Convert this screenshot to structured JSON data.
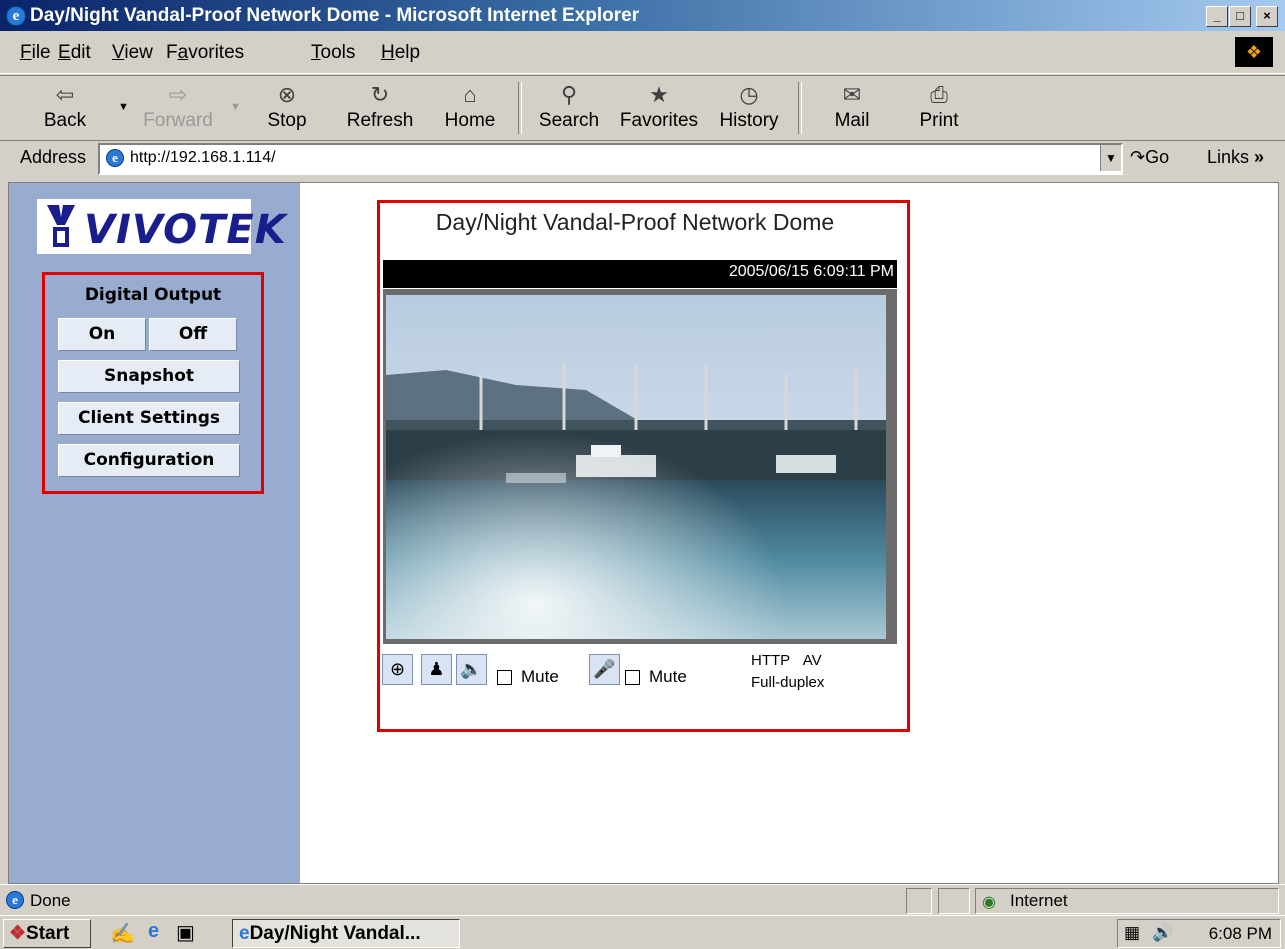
{
  "window": {
    "title": "Day/Night Vandal-Proof Network Dome - Microsoft Internet Explorer",
    "controls": [
      "_",
      "□",
      "×"
    ]
  },
  "menu": {
    "items": [
      "File",
      "Edit",
      "View",
      "Favorites",
      "Tools",
      "Help"
    ],
    "accel": [
      "F",
      "E",
      "V",
      "a",
      "T",
      "H"
    ]
  },
  "toolbar": {
    "back": "Back",
    "forward": "Forward",
    "stop": "Stop",
    "refresh": "Refresh",
    "home": "Home",
    "search": "Search",
    "favorites": "Favorites",
    "history": "History",
    "mail": "Mail",
    "print": "Print"
  },
  "address": {
    "label": "Address",
    "url": "http://192.168.1.114/",
    "go": "Go",
    "links": "Links"
  },
  "sidebar": {
    "logo_text": "VIVOTEK",
    "digital_output_label": "Digital Output",
    "on": "On",
    "off": "Off",
    "snapshot": "Snapshot",
    "client_settings": "Client Settings",
    "configuration": "Configuration"
  },
  "main": {
    "camera_title": "Day/Night Vandal-Proof Network Dome",
    "timestamp": "2005/06/15 6:09:11 PM",
    "mute_speaker": "Mute",
    "mute_mic": "Mute",
    "protocol": "HTTP",
    "stream": "AV",
    "duplex": "Full-duplex",
    "icons": [
      "zoom-icon",
      "talk-icon",
      "speaker-icon",
      "microphone-icon"
    ]
  },
  "status": {
    "text": "Done",
    "zone": "Internet"
  },
  "taskbar": {
    "start": "Start",
    "task_label": "Day/Night Vandal...",
    "clock": "6:08 PM"
  },
  "colors": {
    "highlight_border": "#e00000",
    "sidebar_bg": "#98acd0",
    "logo_blue": "#1a1d8c"
  }
}
